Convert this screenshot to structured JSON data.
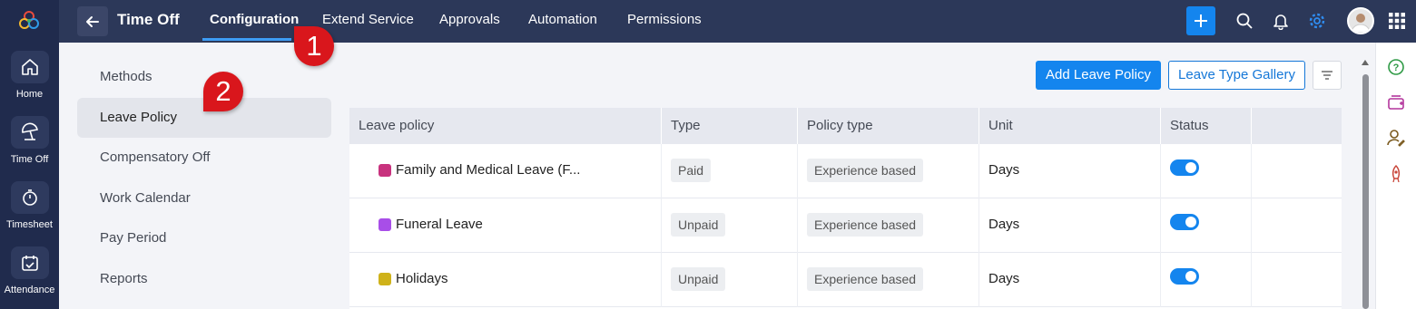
{
  "rail": {
    "items": [
      {
        "label": "Home",
        "icon": "home-icon"
      },
      {
        "label": "Time Off",
        "icon": "beach-umbrella-icon"
      },
      {
        "label": "Timesheet",
        "icon": "stopwatch-icon"
      },
      {
        "label": "Attendance",
        "icon": "calendar-check-icon"
      }
    ]
  },
  "header": {
    "title": "Time Off",
    "tabs": [
      {
        "label": "Configuration",
        "active": true
      },
      {
        "label": "Extend Service",
        "active": false
      },
      {
        "label": "Approvals",
        "active": false
      },
      {
        "label": "Automation",
        "active": false
      },
      {
        "label": "Permissions",
        "active": false
      }
    ]
  },
  "annotations": {
    "one": "1",
    "two": "2"
  },
  "subnav": {
    "items": [
      {
        "label": "Methods"
      },
      {
        "label": "Leave Policy",
        "active": true
      },
      {
        "label": "Compensatory Off"
      },
      {
        "label": "Work Calendar"
      },
      {
        "label": "Pay Period"
      },
      {
        "label": "Reports"
      }
    ]
  },
  "actions": {
    "add_label": "Add Leave Policy",
    "gallery_label": "Leave Type Gallery"
  },
  "table": {
    "columns": [
      "Leave policy",
      "Type",
      "Policy type",
      "Unit",
      "Status"
    ],
    "rows": [
      {
        "name": "Family and Medical Leave (F...",
        "color": "#c8327e",
        "type": "Paid",
        "policy_type": "Experience based",
        "unit": "Days",
        "enabled": true
      },
      {
        "name": "Funeral Leave",
        "color": "#a84ee8",
        "type": "Unpaid",
        "policy_type": "Experience based",
        "unit": "Days",
        "enabled": true
      },
      {
        "name": "Holidays",
        "color": "#cfb21a",
        "type": "Unpaid",
        "policy_type": "Experience based",
        "unit": "Days",
        "enabled": true
      }
    ]
  },
  "colors": {
    "accent": "#1485ee",
    "topbar": "#2c3859",
    "rail": "#202b4d",
    "badge": "#d9161c"
  }
}
